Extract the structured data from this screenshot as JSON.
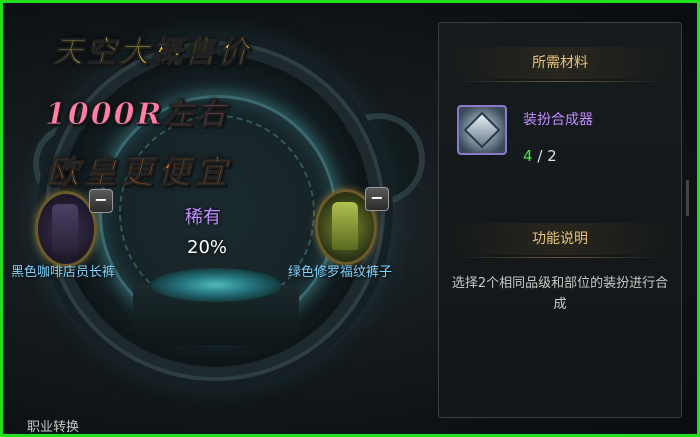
{
  "promo": {
    "line1": "天空大概售价",
    "line2": "1000R左右",
    "line3": "欧皇更便宜"
  },
  "synthesis": {
    "left_slot": {
      "name": "黑色咖啡店员长裤",
      "remove_label": "−"
    },
    "right_slot": {
      "name": "绿色修罗福纹裤子",
      "remove_label": "−"
    },
    "result_rarity": "稀有",
    "success_rate": "20%"
  },
  "footer": {
    "job_change_label": "职业转换"
  },
  "panel": {
    "materials_header": "所需材料",
    "material": {
      "name": "装扮合成器",
      "have": "4",
      "separator": " / ",
      "need": "2",
      "icon": "synthesizer-cube-icon"
    },
    "function_header": "功能说明",
    "function_desc": "选择2个相同品级和部位的装扮进行合成"
  },
  "colors": {
    "frame_border": "#22e01c",
    "rarity": "#c28cff",
    "item_name": "#7fd4ff",
    "header": "#e6c27a",
    "have_count": "#4ee04a"
  }
}
